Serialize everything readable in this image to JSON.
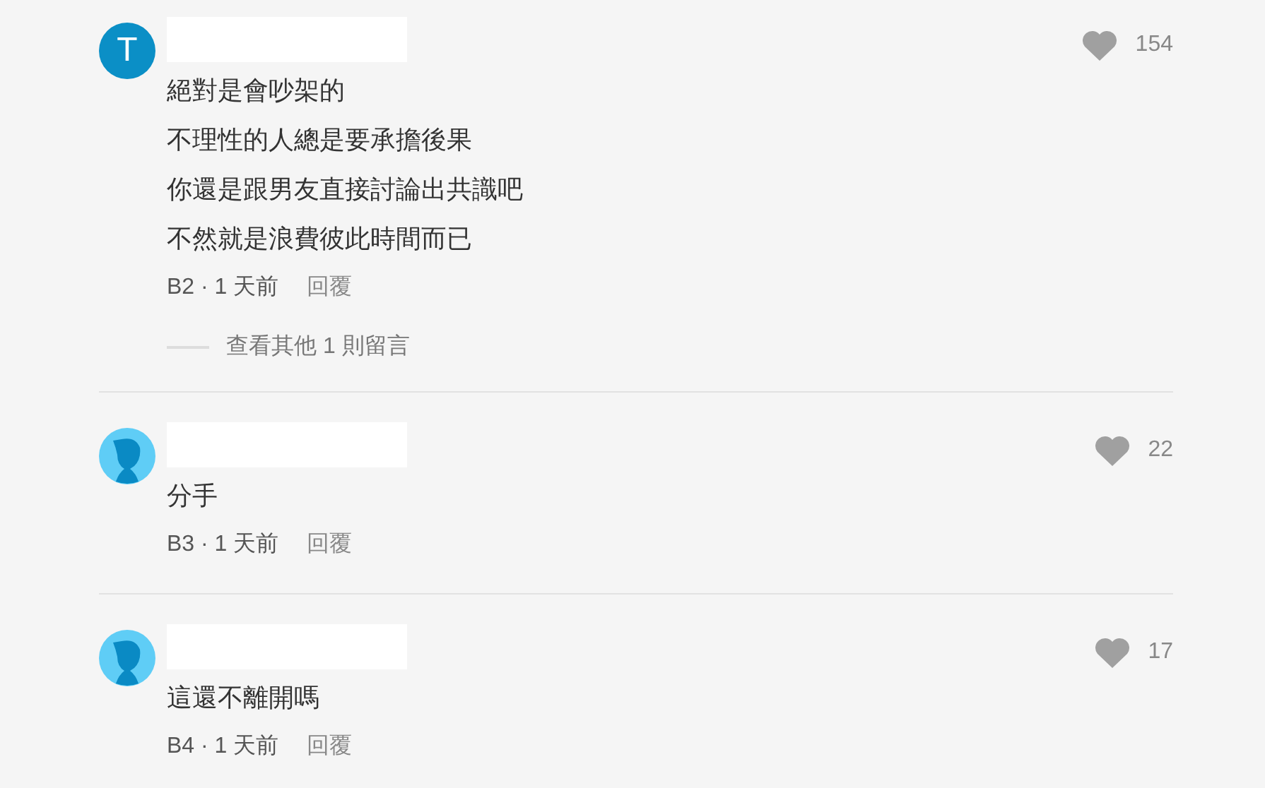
{
  "comments": [
    {
      "avatar": {
        "kind": "letter",
        "letter": "T"
      },
      "lines": [
        "絕對是會吵架的",
        "不理性的人總是要承擔後果",
        "你還是跟男友直接討論出共識吧",
        "不然就是浪費彼此時間而已"
      ],
      "meta": "B2 · 1 天前",
      "reply": "回覆",
      "likes": "154",
      "more_replies": "查看其他 1 則留言"
    },
    {
      "avatar": {
        "kind": "silhouette"
      },
      "lines": [
        "分手"
      ],
      "meta": "B3 · 1 天前",
      "reply": "回覆",
      "likes": "22"
    },
    {
      "avatar": {
        "kind": "silhouette"
      },
      "lines": [
        "這還不離開嗎"
      ],
      "meta": "B4 · 1 天前",
      "reply": "回覆",
      "likes": "17"
    }
  ]
}
